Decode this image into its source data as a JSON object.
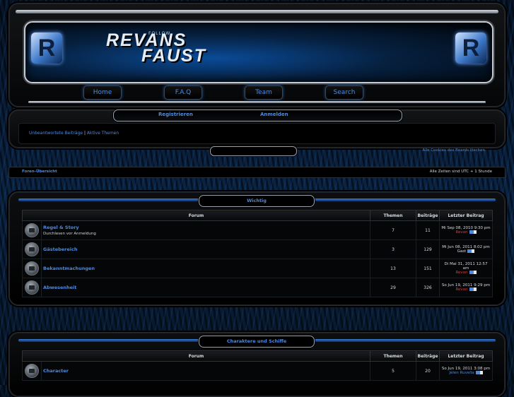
{
  "header": {
    "logo_line1": "REVANS",
    "logo_line2": "FAUST",
    "logo_tag": "FOLLOW",
    "badge_left": "R",
    "badge_right": "R"
  },
  "nav": {
    "home": "Home",
    "faq": "F.A.Q",
    "team": "Team",
    "search": "Search"
  },
  "login": {
    "register": "Registrieren",
    "login": "Anmelden"
  },
  "quicklinks": {
    "unanswered": "Unbeantwortete Beiträge",
    "separator": "|",
    "active": "Aktive Themen"
  },
  "cookies": "Alle Cookies des Boards löschen",
  "breadcrumb": {
    "index": "Foren-Übersicht",
    "timezone": "Alle Zeiten sind UTC + 1 Stunde"
  },
  "columns": {
    "forum": "Forum",
    "topics": "Themen",
    "posts": "Beiträge",
    "last_post": "Letzter Beitrag"
  },
  "categories": [
    {
      "title": "Wichtig",
      "forums": [
        {
          "name": "Regel & Story",
          "desc": "Durchlesen vor Anmeldung",
          "topics": "7",
          "posts": "11",
          "last_date": "Mi Sep 08, 2010 9:30 pm",
          "last_author": "Revan",
          "author_color": "#d93b3b"
        },
        {
          "name": "Gästebereich",
          "desc": "",
          "topics": "3",
          "posts": "129",
          "last_date": "Mi Jun 08, 2011 8:02 pm",
          "last_author": "Gast",
          "author_color": "#d6dbe2"
        },
        {
          "name": "Bekanntmachungen",
          "desc": "",
          "topics": "13",
          "posts": "151",
          "last_date": "Di Mai 31, 2011 12:57 am",
          "last_author": "Revan",
          "author_color": "#d93b3b"
        },
        {
          "name": "Abwesenheit",
          "desc": "",
          "topics": "29",
          "posts": "326",
          "last_date": "So Jun 19, 2011 9:29 pm",
          "last_author": "Revan",
          "author_color": "#d93b3b"
        }
      ]
    },
    {
      "title": "Charaktere und Schiffe",
      "forums": [
        {
          "name": "Character",
          "desc": "",
          "topics": "5",
          "posts": "20",
          "last_date": "So Jun 19, 2011 3:08 pm",
          "last_author": "Jelen Ruvella",
          "author_color": "#4d8ae0"
        }
      ]
    }
  ]
}
